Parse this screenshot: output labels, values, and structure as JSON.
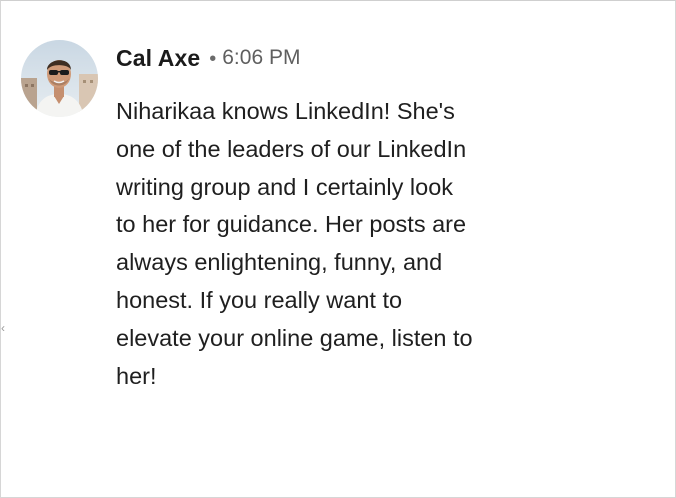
{
  "comment": {
    "author_name": "Cal Axe",
    "separator": "•",
    "timestamp": "6:06 PM",
    "avatar_icon": "user-avatar-photo",
    "message_lines": [
      "Niharikaa knows LinkedIn! She's",
      "one of the leaders of our LinkedIn",
      "writing group and I certainly look",
      "to her for guidance. Her posts are",
      "always enlightening, funny, and",
      "honest. If you really want to",
      "elevate your online game, listen to",
      "her!"
    ]
  },
  "edge_marker": "‹"
}
